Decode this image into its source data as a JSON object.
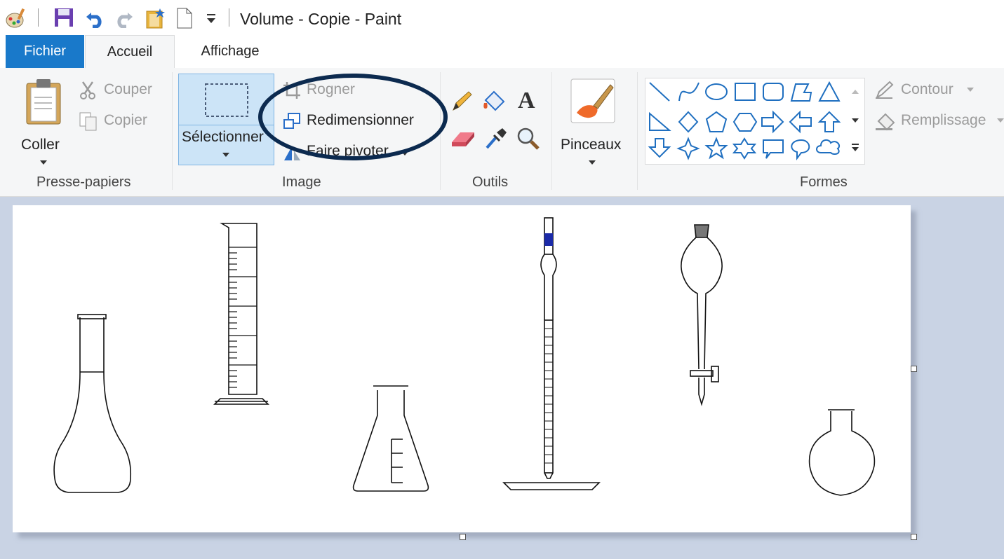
{
  "window": {
    "title": "Volume - Copie - Paint"
  },
  "tabs": {
    "file": "Fichier",
    "home": "Accueil",
    "view": "Affichage"
  },
  "clipboard": {
    "paste": "Coller",
    "cut": "Couper",
    "copy": "Copier",
    "label": "Presse-papiers"
  },
  "image": {
    "select": "Sélectionner",
    "crop": "Rogner",
    "resize": "Redimensionner",
    "rotate": "Faire pivoter",
    "label": "Image"
  },
  "tools": {
    "label": "Outils"
  },
  "brushes": {
    "label": "Pinceaux"
  },
  "shapes": {
    "outline": "Contour",
    "fill": "Remplissage",
    "label": "Formes"
  },
  "colors": {
    "accent": "#1979ca",
    "annotation": "#0c2a4f",
    "selection_bg": "#cce4f7"
  }
}
